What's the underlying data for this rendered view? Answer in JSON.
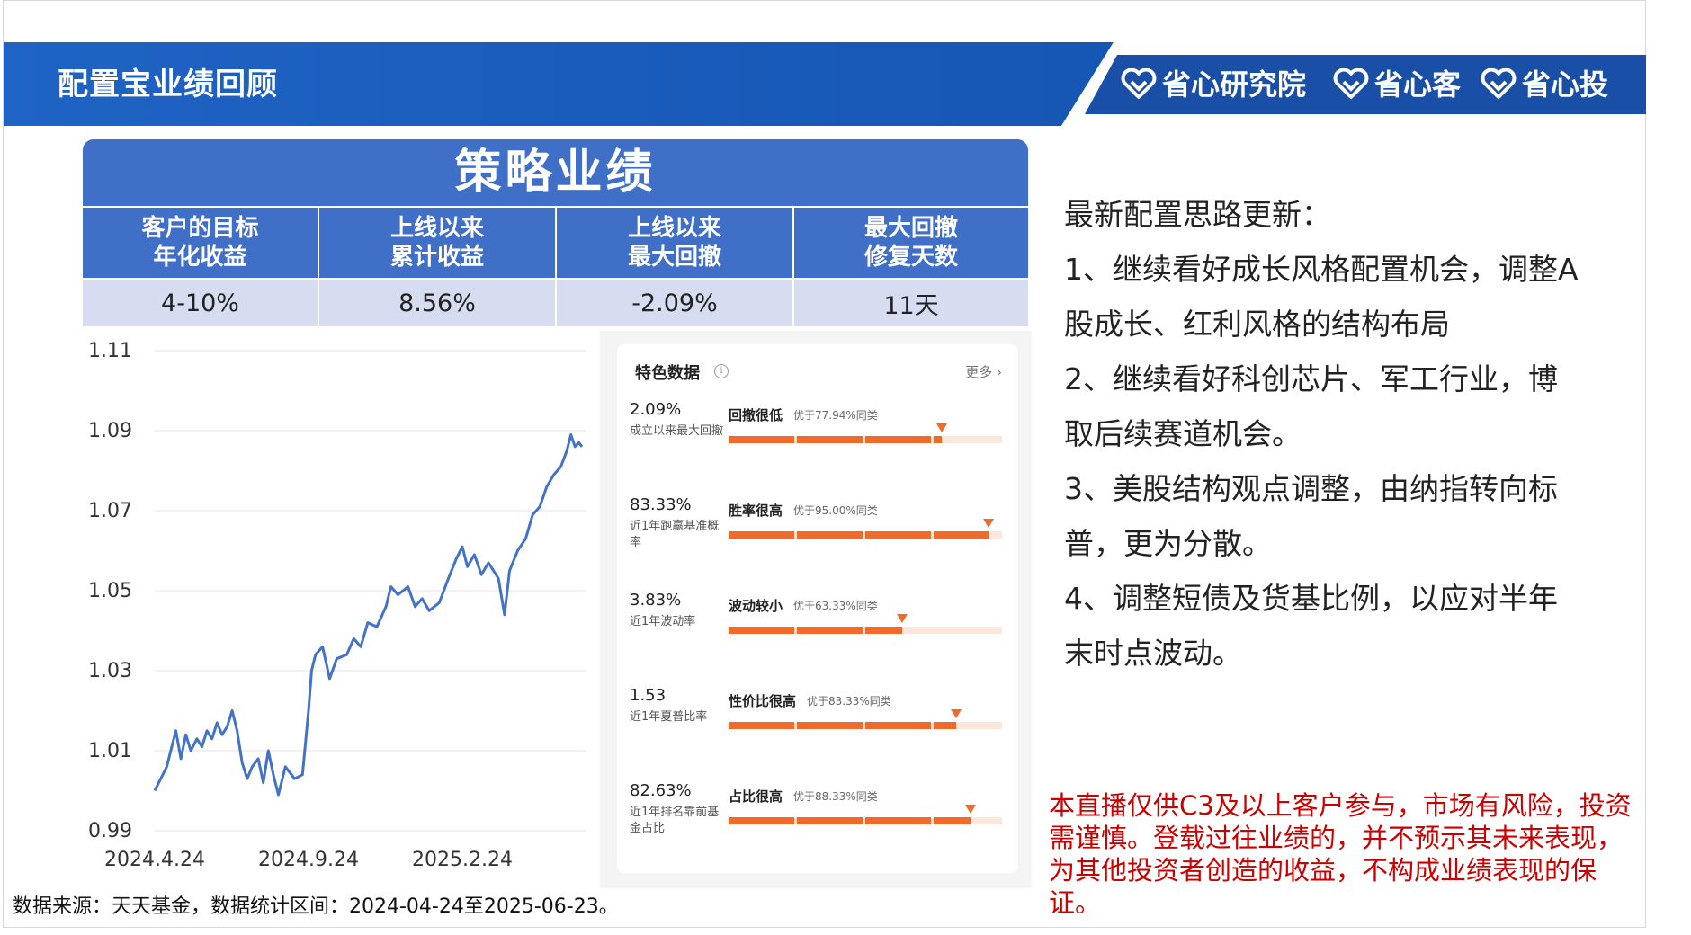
{
  "header": {
    "title": "配置宝业绩回顾",
    "brands": [
      "省心研究院",
      "省心客",
      "省心投"
    ],
    "band_color": "#1a5ab8"
  },
  "strategy": {
    "title": "策略业绩",
    "columns": [
      {
        "label": "客户的目标\n年化收益",
        "value": "4-10%"
      },
      {
        "label": "上线以来\n累计收益",
        "value": "8.56%"
      },
      {
        "label": "上线以来\n最大回撤",
        "value": "-2.09%"
      },
      {
        "label": "最大回撤\n修复天数",
        "value": "11天"
      }
    ]
  },
  "chart_data": {
    "type": "line",
    "x_ticks": [
      "2024.4.24",
      "2024.9.24",
      "2025.2.24"
    ],
    "y_ticks": [
      "1.11",
      "1.09",
      "1.07",
      "1.05",
      "1.03",
      "1.01",
      "0.99"
    ],
    "ylim": [
      0.99,
      1.11
    ],
    "x_range": [
      "2024-04-24",
      "2025-06-23"
    ],
    "line_color": "#4472c4",
    "series": [
      {
        "points": [
          [
            "2024-04-24",
            1.0
          ],
          [
            "2024-04-30",
            1.003
          ],
          [
            "2024-05-06",
            1.006
          ],
          [
            "2024-05-12",
            1.012
          ],
          [
            "2024-05-15",
            1.015
          ],
          [
            "2024-05-20",
            1.008
          ],
          [
            "2024-05-25",
            1.014
          ],
          [
            "2024-05-30",
            1.01
          ],
          [
            "2024-06-05",
            1.013
          ],
          [
            "2024-06-10",
            1.011
          ],
          [
            "2024-06-15",
            1.015
          ],
          [
            "2024-06-20",
            1.013
          ],
          [
            "2024-06-25",
            1.017
          ],
          [
            "2024-06-30",
            1.014
          ],
          [
            "2024-07-05",
            1.016
          ],
          [
            "2024-07-10",
            1.02
          ],
          [
            "2024-07-15",
            1.015
          ],
          [
            "2024-07-20",
            1.007
          ],
          [
            "2024-07-25",
            1.003
          ],
          [
            "2024-07-30",
            1.006
          ],
          [
            "2024-08-05",
            1.008
          ],
          [
            "2024-08-10",
            1.002
          ],
          [
            "2024-08-15",
            1.01
          ],
          [
            "2024-08-20",
            1.004
          ],
          [
            "2024-08-25",
            0.999
          ],
          [
            "2024-09-01",
            1.006
          ],
          [
            "2024-09-10",
            1.003
          ],
          [
            "2024-09-18",
            1.004
          ],
          [
            "2024-09-24",
            1.02
          ],
          [
            "2024-09-27",
            1.03
          ],
          [
            "2024-10-01",
            1.034
          ],
          [
            "2024-10-08",
            1.036
          ],
          [
            "2024-10-15",
            1.028
          ],
          [
            "2024-10-22",
            1.033
          ],
          [
            "2024-11-01",
            1.034
          ],
          [
            "2024-11-08",
            1.038
          ],
          [
            "2024-11-15",
            1.036
          ],
          [
            "2024-11-22",
            1.042
          ],
          [
            "2024-12-01",
            1.041
          ],
          [
            "2024-12-10",
            1.046
          ],
          [
            "2024-12-15",
            1.051
          ],
          [
            "2024-12-22",
            1.049
          ],
          [
            "2025-01-01",
            1.051
          ],
          [
            "2025-01-08",
            1.046
          ],
          [
            "2025-01-15",
            1.048
          ],
          [
            "2025-01-22",
            1.045
          ],
          [
            "2025-02-01",
            1.047
          ],
          [
            "2025-02-10",
            1.053
          ],
          [
            "2025-02-18",
            1.058
          ],
          [
            "2025-02-24",
            1.061
          ],
          [
            "2025-03-01",
            1.056
          ],
          [
            "2025-03-08",
            1.059
          ],
          [
            "2025-03-15",
            1.054
          ],
          [
            "2025-03-22",
            1.057
          ],
          [
            "2025-04-01",
            1.053
          ],
          [
            "2025-04-07",
            1.044
          ],
          [
            "2025-04-12",
            1.055
          ],
          [
            "2025-04-20",
            1.06
          ],
          [
            "2025-04-28",
            1.063
          ],
          [
            "2025-05-05",
            1.069
          ],
          [
            "2025-05-12",
            1.071
          ],
          [
            "2025-05-19",
            1.076
          ],
          [
            "2025-05-26",
            1.079
          ],
          [
            "2025-06-02",
            1.081
          ],
          [
            "2025-06-08",
            1.085
          ],
          [
            "2025-06-12",
            1.089
          ],
          [
            "2025-06-16",
            1.086
          ],
          [
            "2025-06-20",
            1.087
          ],
          [
            "2025-06-23",
            1.086
          ]
        ]
      }
    ]
  },
  "features": {
    "title": "特色数据",
    "info_icon": "info-icon",
    "more_label": "更多 ›",
    "accent": "#f06a2c",
    "track": "#fde7dc",
    "items": [
      {
        "value": "2.09%",
        "label": "成立以来最大回撤",
        "tag": "回撤很低",
        "compare": "优于77.94%同类",
        "pct": 77.94
      },
      {
        "value": "83.33%",
        "label": "近1年跑赢基准概率",
        "tag": "胜率很高",
        "compare": "优于95.00%同类",
        "pct": 95.0
      },
      {
        "value": "3.83%",
        "label": "近1年波动率",
        "tag": "波动较小",
        "compare": "优于63.33%同类",
        "pct": 63.33
      },
      {
        "value": "1.53",
        "label": "近1年夏普比率",
        "tag": "性价比很高",
        "compare": "优于83.33%同类",
        "pct": 83.33
      },
      {
        "value": "82.63%",
        "label": "近1年排名靠前基金占比",
        "tag": "占比很高",
        "compare": "优于88.33%同类",
        "pct": 88.33
      }
    ]
  },
  "notes": {
    "lines": [
      "最新配置思路更新：",
      "1、继续看好成长风格配置机会，调整A",
      "股成长、红利风格的结构布局",
      "2、继续看好科创芯片、军工行业，博",
      "取后续赛道机会。",
      "3、美股结构观点调整，由纳指转向标",
      "普，更为分散。",
      "4、调整短债及货基比例，以应对半年",
      "末时点波动。"
    ]
  },
  "disclaimer": "本直播仅供C3及以上客户参与，市场有风险，投资需谨慎。登载过往业绩的，并不预示其未来表现，为其他投资者创造的收益，不构成业绩表现的保证。",
  "source": "数据来源：天天基金，数据统计区间：2024-04-24至2025-06-23。"
}
